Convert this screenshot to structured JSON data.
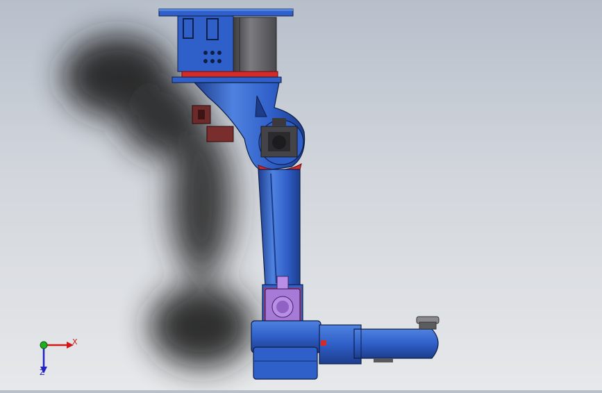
{
  "viewport": {
    "colors": {
      "background_top": "#b7bfcb",
      "background_bottom": "#e6e8ea",
      "robot_body": "#2f5fc8",
      "robot_body_light": "#4f82e0",
      "robot_body_dark": "#1d3d8c",
      "accent_red": "#d42a2a",
      "motor_purple": "#a77ad8",
      "motor_gray": "#6f6f73",
      "shadow": "#2a2a2a"
    }
  },
  "triad": {
    "x_label": "X",
    "z_label": "Z",
    "colors": {
      "x": "#d01818",
      "y": "#1fae1f",
      "z": "#2222c0"
    }
  }
}
